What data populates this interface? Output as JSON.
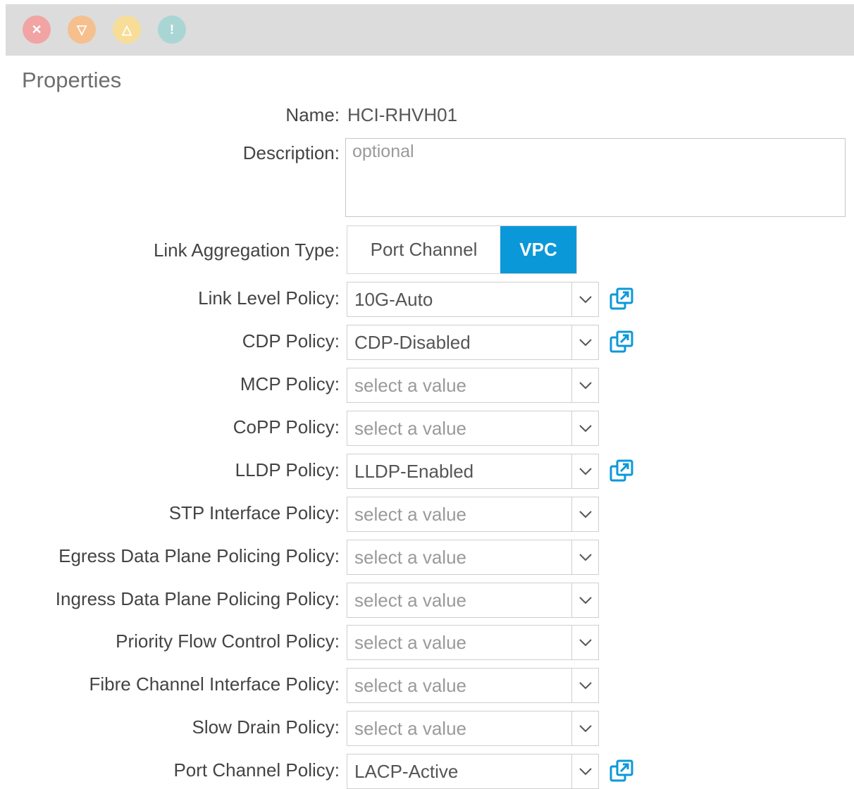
{
  "fault_bar": {
    "icons": [
      {
        "name": "critical-fault-icon",
        "glyph": "✕",
        "color": "#f2a3a3"
      },
      {
        "name": "major-fault-icon",
        "glyph": "▽",
        "color": "#f5c08e"
      },
      {
        "name": "minor-fault-icon",
        "glyph": "△",
        "color": "#f7dd97"
      },
      {
        "name": "warning-fault-icon",
        "glyph": "!",
        "color": "#a9d6d4"
      }
    ]
  },
  "properties": {
    "title": "Properties",
    "name_label": "Name:",
    "name_value": "HCI-RHVH01",
    "description_label": "Description:",
    "description_placeholder": "optional",
    "link_aggregation_label": "Link Aggregation Type:",
    "link_aggregation_options": [
      "Port Channel",
      "VPC"
    ],
    "link_aggregation_selected": "VPC",
    "accent_color": "#0b98d8",
    "policies": [
      {
        "label": "Link Level Policy:",
        "value": "10G-Auto",
        "is_set": true,
        "launch_icon": true
      },
      {
        "label": "CDP Policy:",
        "value": "CDP-Disabled",
        "is_set": true,
        "launch_icon": true
      },
      {
        "label": "MCP Policy:",
        "value": "select a value",
        "is_set": false,
        "launch_icon": false
      },
      {
        "label": "CoPP Policy:",
        "value": "select a value",
        "is_set": false,
        "launch_icon": false
      },
      {
        "label": "LLDP Policy:",
        "value": "LLDP-Enabled",
        "is_set": true,
        "launch_icon": true
      },
      {
        "label": "STP Interface Policy:",
        "value": "select a value",
        "is_set": false,
        "launch_icon": false
      },
      {
        "label": "Egress Data Plane Policing Policy:",
        "value": "select a value",
        "is_set": false,
        "launch_icon": false
      },
      {
        "label": "Ingress Data Plane Policing Policy:",
        "value": "select a value",
        "is_set": false,
        "launch_icon": false
      },
      {
        "label": "Priority Flow Control Policy:",
        "value": "select a value",
        "is_set": false,
        "launch_icon": false
      },
      {
        "label": "Fibre Channel Interface Policy:",
        "value": "select a value",
        "is_set": false,
        "launch_icon": false
      },
      {
        "label": "Slow Drain Policy:",
        "value": "select a value",
        "is_set": false,
        "launch_icon": false
      },
      {
        "label": "Port Channel Policy:",
        "value": "LACP-Active",
        "is_set": true,
        "launch_icon": true
      }
    ]
  }
}
